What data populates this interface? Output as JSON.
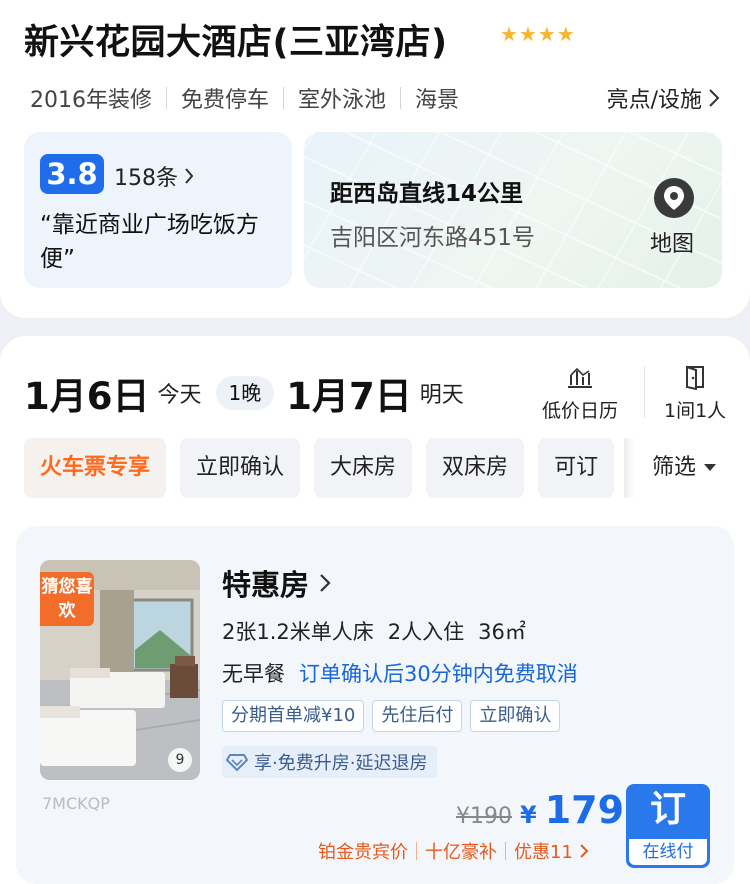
{
  "hotel": {
    "name": "新兴花园大酒店(三亚湾店)",
    "star_count": 4,
    "star_color": "#f7b52c",
    "tags": [
      "2016年装修",
      "免费停车",
      "室外泳池",
      "海景"
    ],
    "highlights_label": "亮点/设施"
  },
  "review": {
    "score": "3.8",
    "count": "158条",
    "quote": "“靠近商业广场吃饭方便”"
  },
  "location": {
    "distance": "距西岛直线14公里",
    "address": "吉阳区河东路451号",
    "map_label": "地图"
  },
  "dates": {
    "checkin": "1月6日",
    "checkin_note": "今天",
    "nights": "1晚",
    "checkout": "1月7日",
    "checkout_note": "明天",
    "calendar_label": "低价日历",
    "guests_label": "1间1人"
  },
  "filters": {
    "chips": [
      "火车票专享",
      "立即确认",
      "大床房",
      "双床房",
      "可订"
    ],
    "filter_label": "筛选"
  },
  "room": {
    "badge": "猜您喜欢",
    "photo_count": "9",
    "code": "7MCKQP",
    "title": "特惠房",
    "beds": "2张1.2米单人床",
    "capacity": "2人入住",
    "area": "36㎡",
    "meal": "无早餐",
    "cancel": "订单确认后30分钟内免费取消",
    "badges": [
      "分期首单减¥10",
      "先住后付",
      "立即确认"
    ],
    "perk": "享·免费升房·延迟退房",
    "old_price": "¥190",
    "currency": "¥",
    "price": "179",
    "promos": [
      "铂金贵宾价",
      "十亿豪补",
      "优惠11"
    ],
    "book_label": "订",
    "pay_label": "在线付"
  },
  "colors": {
    "accent_blue": "#1c6ce8",
    "promo_orange": "#ff6a1e",
    "score_blue": "#1f6dea"
  }
}
